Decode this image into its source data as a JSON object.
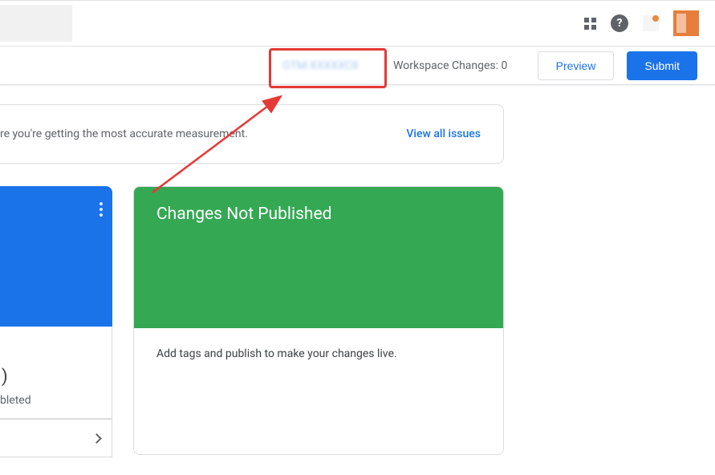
{
  "topbar": {},
  "actionbar": {
    "container_id": "GTM-XXXXXC8",
    "workspace_label": "Workspace Changes:",
    "workspace_count": "0",
    "preview_label": "Preview",
    "submit_label": "Submit"
  },
  "issues": {
    "text": "re you're getting the most accurate measurement.",
    "link": "View all issues"
  },
  "partial": {
    "paren": ")",
    "bleted": "bleted"
  },
  "publish_card": {
    "title": "Changes Not Published",
    "body": "Add tags and publish to make your changes live."
  },
  "annotation": {
    "highlight": "container-id-highlight"
  }
}
